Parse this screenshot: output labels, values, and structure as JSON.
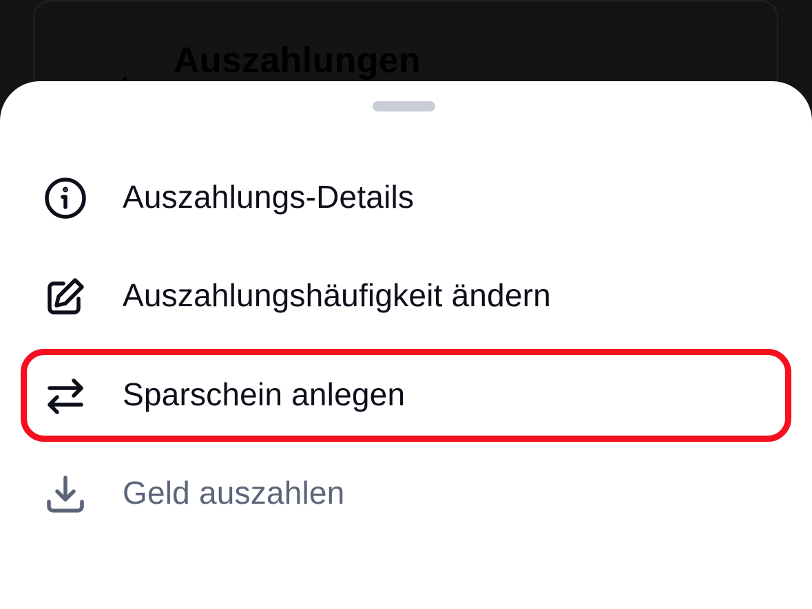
{
  "background": {
    "title": "Auszahlungen"
  },
  "menu": {
    "items": [
      {
        "label": "Auszahlungs-Details",
        "icon": "info-circle-icon",
        "disabled": false
      },
      {
        "label": "Auszahlungshäufigkeit ändern",
        "icon": "edit-square-icon",
        "disabled": false
      },
      {
        "label": "Sparschein anlegen",
        "icon": "arrows-left-right-icon",
        "disabled": false,
        "highlighted": true
      },
      {
        "label": "Geld auszahlen",
        "icon": "download-icon",
        "disabled": true
      }
    ]
  },
  "colors": {
    "text": "#0c0f1a",
    "disabled_text": "#5b6478",
    "highlight": "#f5101f",
    "handle": "#c9ced8"
  }
}
